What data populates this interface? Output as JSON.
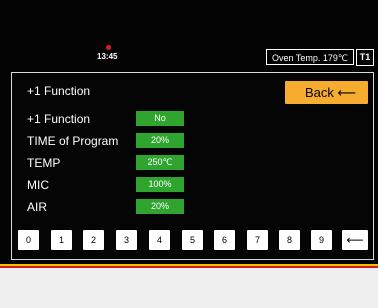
{
  "status": {
    "clock": "13:45",
    "oven_temp": "Oven Temp. 179℃",
    "tray_badge": "T1"
  },
  "page": {
    "title": "+1 Function",
    "back_label": "Back",
    "back_arrow": "⟵"
  },
  "rows": [
    {
      "label": "+1 Function",
      "value": "No"
    },
    {
      "label": "TIME of Program",
      "value": "20%"
    },
    {
      "label": "TEMP",
      "value": "250℃"
    },
    {
      "label": "MIC",
      "value": "100%"
    },
    {
      "label": "AIR",
      "value": "20%"
    }
  ],
  "keypad": {
    "keys": [
      "0",
      "1",
      "2",
      "3",
      "4",
      "5",
      "6",
      "7",
      "8",
      "9"
    ],
    "backspace": "⟵"
  },
  "colors": {
    "accent": "#f6ad2f",
    "value_bg": "#2fa52f",
    "status_dot": "#e11b1b",
    "stripe_yellow": "#f5c400",
    "stripe_red": "#d81818"
  }
}
